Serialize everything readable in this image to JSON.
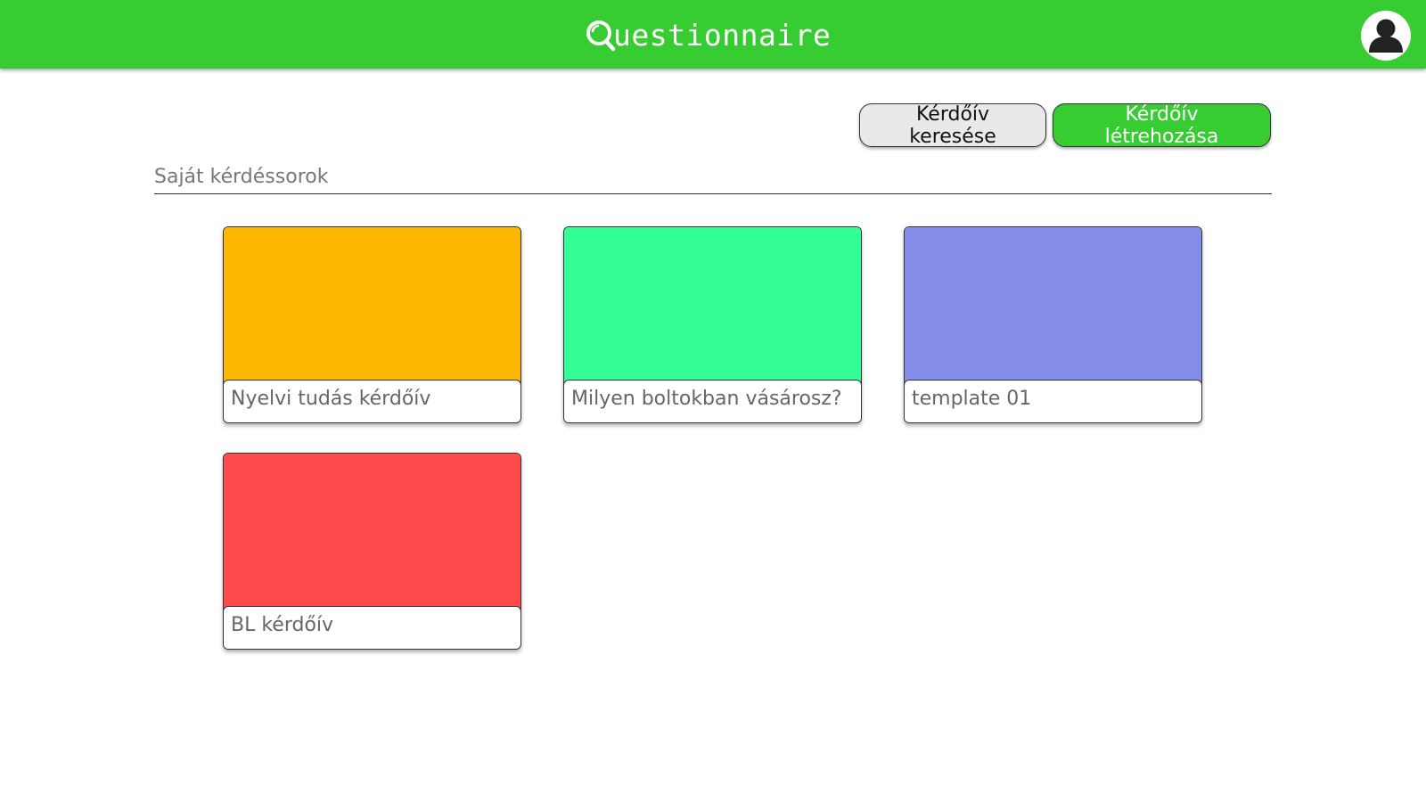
{
  "header": {
    "app_title": "uestionnaire",
    "logo_icon": "magnifier-q-icon",
    "avatar_icon": "user-avatar-icon",
    "bar_color": "#38cc33"
  },
  "actions": {
    "search_label": "Kérdőív keresése",
    "create_label": "Kérdőív létrehozása"
  },
  "section": {
    "title": "Saját kérdéssorok"
  },
  "questionnaires": [
    {
      "title": "Nyelvi tudás kérdőív",
      "color": "#fdb700"
    },
    {
      "title": "Milyen boltokban vásárosz?",
      "color": "#33ff96"
    },
    {
      "title": "template 01",
      "color": "#848ee9"
    },
    {
      "title": "BL kérdőív",
      "color": "#ff4b4b"
    }
  ]
}
